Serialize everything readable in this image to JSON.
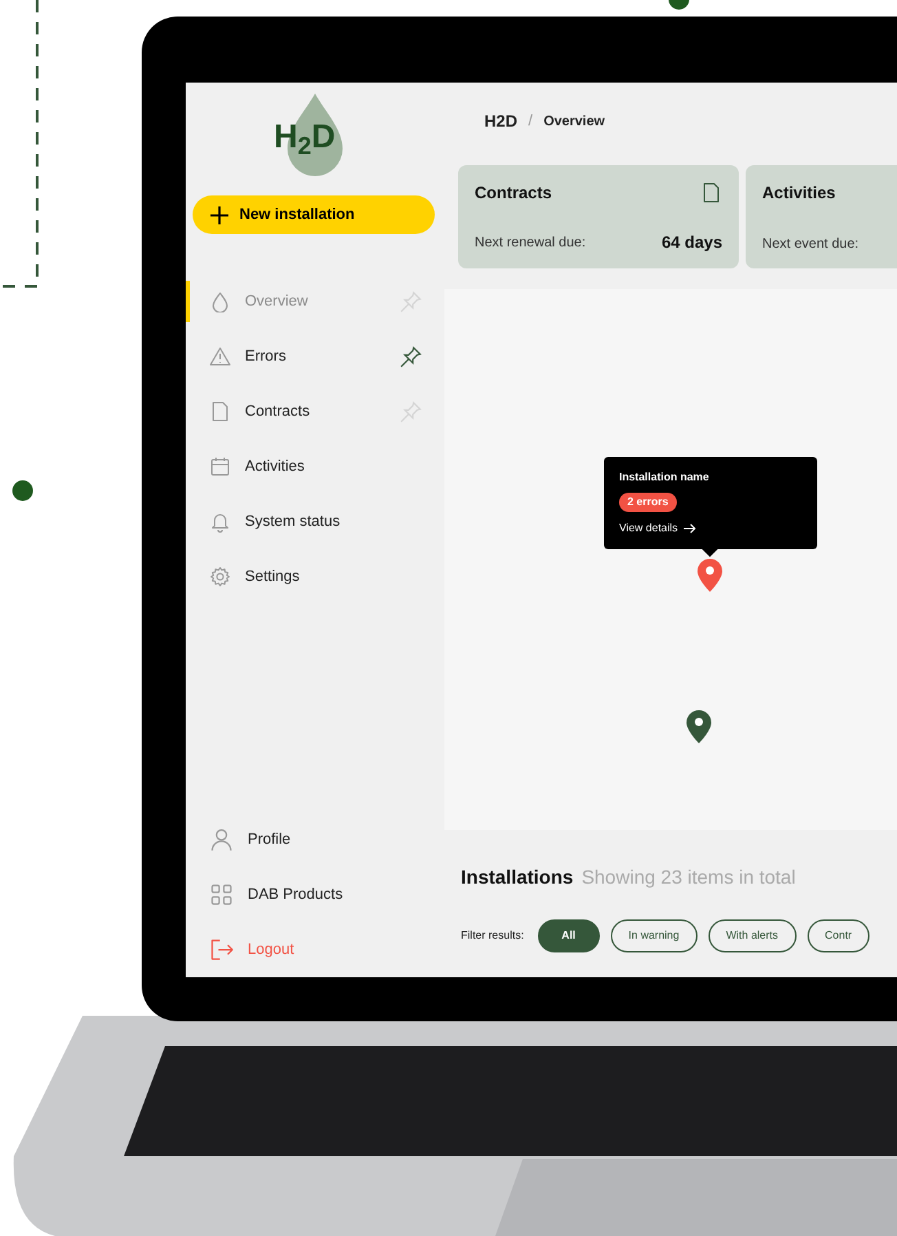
{
  "logo": {
    "text": "H$_{2}$D"
  },
  "new_button": {
    "label": "New installation"
  },
  "nav": [
    {
      "label": "Overview",
      "kind": "drop",
      "selected": true,
      "pinned": false
    },
    {
      "label": "Errors",
      "kind": "warning",
      "selected": false,
      "pinned": true
    },
    {
      "label": "Contracts",
      "kind": "document",
      "selected": false,
      "pinned": false
    },
    {
      "label": "Activities",
      "kind": "calendar",
      "selected": false
    },
    {
      "label": "System status",
      "kind": "bell",
      "selected": false
    },
    {
      "label": "Settings",
      "kind": "gear",
      "selected": false
    }
  ],
  "bottom_nav": [
    {
      "label": "Profile",
      "kind": "person"
    },
    {
      "label": "DAB Products",
      "kind": "grid"
    },
    {
      "label": "Logout",
      "kind": "logout"
    }
  ],
  "breadcrumb": {
    "items": [
      "H2D",
      "Overview"
    ],
    "separator": "/"
  },
  "cards": [
    {
      "title": "Contracts",
      "label": "Next renewal due:",
      "value": "64 days",
      "kind": "document"
    },
    {
      "title": "Activities",
      "label": "Next event due:"
    }
  ],
  "map": {
    "tooltip": {
      "title": "Installation name",
      "badge": "2 errors",
      "link": "View details"
    },
    "pins": [
      {
        "color": "#f25244"
      },
      {
        "color": "#35573a"
      }
    ]
  },
  "installations": {
    "title": "Installations",
    "subtitle": "Showing 23 items in total",
    "filter_label": "Filter results:",
    "filters": [
      {
        "label": "All",
        "selected": true
      },
      {
        "label": "In warning",
        "selected": false
      },
      {
        "label": "With alerts",
        "selected": false
      },
      {
        "label": "Contr",
        "selected": false
      }
    ]
  }
}
